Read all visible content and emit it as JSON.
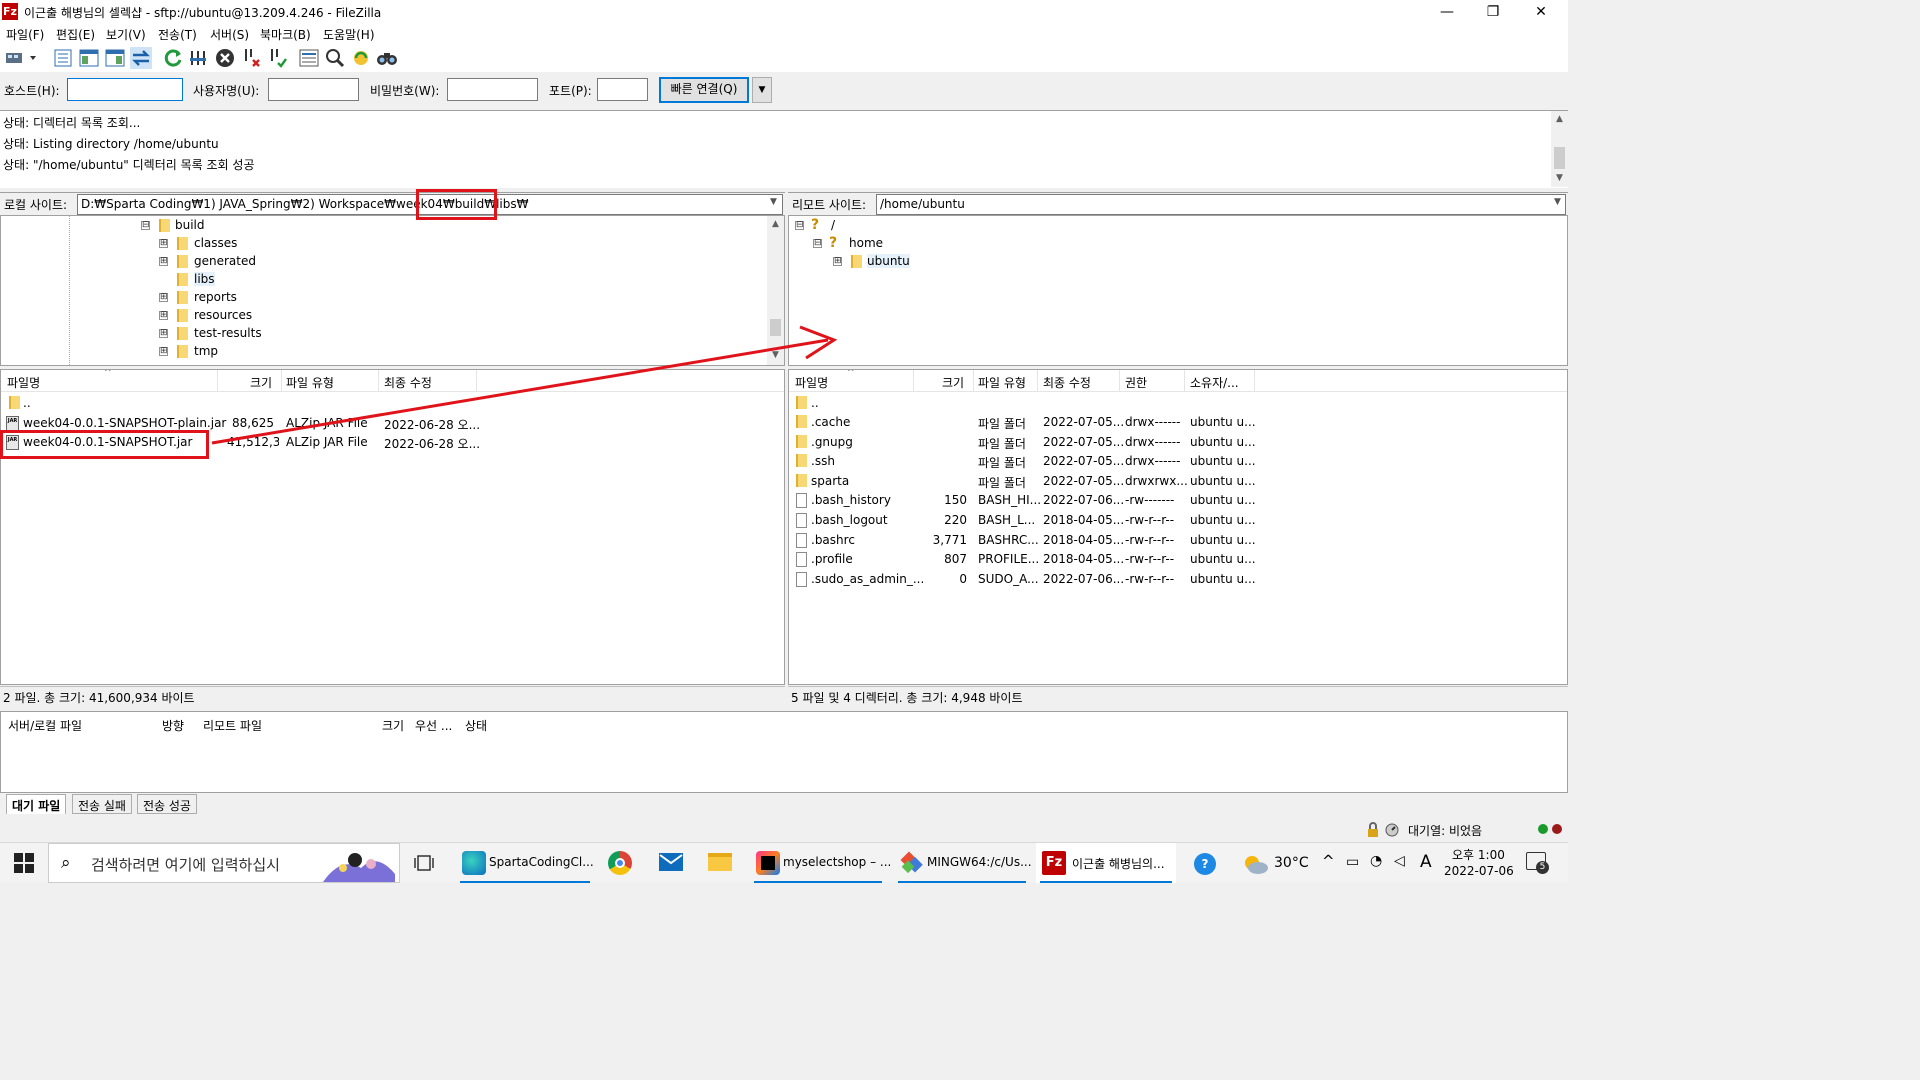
{
  "window": {
    "title": "이근출 해병님의 셀렉샵 - sftp://ubuntu@13.209.4.246 - FileZilla",
    "logo": "Fz",
    "min": "—",
    "max": "❐",
    "close": "✕"
  },
  "menu": [
    "파일(F)",
    "편집(E)",
    "보기(V)",
    "전송(T)",
    "서버(S)",
    "북마크(B)",
    "도움말(H)"
  ],
  "quick": {
    "host_label": "호스트(H):",
    "host_value": "",
    "user_label": "사용자명(U):",
    "user_value": "",
    "pass_label": "비밀번호(W):",
    "pass_value": "",
    "port_label": "포트(P):",
    "port_value": "",
    "connect": "빠른 연결(Q)"
  },
  "log": [
    "상태: 디렉터리 목록 조회...",
    "상태: Listing directory /home/ubuntu",
    "상태: \"/home/ubuntu\" 디렉터리 목록 조회 성공"
  ],
  "local": {
    "label": "로컬 사이트:",
    "path": "D:₩Sparta Coding₩1) JAVA_Spring₩2) Workspace₩week04₩build₩libs₩",
    "tree": [
      {
        "name": "build",
        "exp": "⊟"
      },
      {
        "name": "classes",
        "exp": "⊞"
      },
      {
        "name": "generated",
        "exp": "⊞"
      },
      {
        "name": "libs",
        "exp": ""
      },
      {
        "name": "reports",
        "exp": "⊞"
      },
      {
        "name": "resources",
        "exp": "⊞"
      },
      {
        "name": "test-results",
        "exp": "⊞"
      },
      {
        "name": "tmp",
        "exp": "⊞"
      }
    ],
    "columns": [
      "파일명",
      "크기",
      "파일 유형",
      "최종 수정"
    ],
    "files": [
      {
        "name": "..",
        "size": "",
        "type": "",
        "modified": "",
        "kind": "folder"
      },
      {
        "name": "week04-0.0.1-SNAPSHOT-plain.jar",
        "size": "88,625",
        "type": "ALZip JAR File",
        "modified": "2022-06-28 오...",
        "kind": "jar"
      },
      {
        "name": "week04-0.0.1-SNAPSHOT.jar",
        "size": "41,512,3...",
        "type": "ALZip JAR File",
        "modified": "2022-06-28 오...",
        "kind": "jar"
      }
    ],
    "status": "2 파일. 총 크기: 41,600,934 바이트"
  },
  "remote": {
    "label": "리모트 사이트:",
    "path": "/home/ubuntu",
    "tree": [
      {
        "name": "/",
        "exp": "⊟"
      },
      {
        "name": "home",
        "exp": "⊟"
      },
      {
        "name": "ubuntu",
        "exp": "⊞"
      }
    ],
    "columns": [
      "파일명",
      "크기",
      "파일 유형",
      "최종 수정",
      "권한",
      "소유자/..."
    ],
    "files": [
      {
        "name": "..",
        "size": "",
        "type": "",
        "modified": "",
        "perm": "",
        "owner": "",
        "kind": "folder"
      },
      {
        "name": ".cache",
        "size": "",
        "type": "파일 폴더",
        "modified": "2022-07-05...",
        "perm": "drwx------",
        "owner": "ubuntu u...",
        "kind": "folder"
      },
      {
        "name": ".gnupg",
        "size": "",
        "type": "파일 폴더",
        "modified": "2022-07-05...",
        "perm": "drwx------",
        "owner": "ubuntu u...",
        "kind": "folder"
      },
      {
        "name": ".ssh",
        "size": "",
        "type": "파일 폴더",
        "modified": "2022-07-05...",
        "perm": "drwx------",
        "owner": "ubuntu u...",
        "kind": "folder"
      },
      {
        "name": "sparta",
        "size": "",
        "type": "파일 폴더",
        "modified": "2022-07-05...",
        "perm": "drwxrwx...",
        "owner": "ubuntu u...",
        "kind": "folder"
      },
      {
        "name": ".bash_history",
        "size": "150",
        "type": "BASH_HI...",
        "modified": "2022-07-06...",
        "perm": "-rw-------",
        "owner": "ubuntu u...",
        "kind": "file"
      },
      {
        "name": ".bash_logout",
        "size": "220",
        "type": "BASH_L...",
        "modified": "2018-04-05...",
        "perm": "-rw-r--r--",
        "owner": "ubuntu u...",
        "kind": "file"
      },
      {
        "name": ".bashrc",
        "size": "3,771",
        "type": "BASHRC...",
        "modified": "2018-04-05...",
        "perm": "-rw-r--r--",
        "owner": "ubuntu u...",
        "kind": "file"
      },
      {
        "name": ".profile",
        "size": "807",
        "type": "PROFILE...",
        "modified": "2018-04-05...",
        "perm": "-rw-r--r--",
        "owner": "ubuntu u...",
        "kind": "file"
      },
      {
        "name": ".sudo_as_admin_...",
        "size": "0",
        "type": "SUDO_A...",
        "modified": "2022-07-06...",
        "perm": "-rw-r--r--",
        "owner": "ubuntu u...",
        "kind": "file"
      }
    ],
    "status": "5 파일 및 4 디렉터리. 총 크기: 4,948 바이트"
  },
  "queue": {
    "columns": [
      "서버/로컬 파일",
      "방향",
      "리모트 파일",
      "크기",
      "우선 ...",
      "상태"
    ],
    "tabs": [
      "대기 파일",
      "전송 실패",
      "전송 성공"
    ],
    "queue_status": "대기열: 비었음"
  },
  "taskbar": {
    "search_placeholder": "검색하려면 여기에 입력하십시",
    "apps": [
      "SpartaCodingCl...",
      "myselectshop – ...",
      "MINGW64:/c/Us...",
      "이근출 해병님의..."
    ],
    "weather": "30°C",
    "ime": "A",
    "ampm": "오후 1:00",
    "date": "2022-07-06",
    "notif_count": "5"
  },
  "colors": {
    "accent": "#0078d7",
    "annotation": "#e0131a",
    "folder": "#f8d775",
    "filezilla": "#bf0000"
  }
}
